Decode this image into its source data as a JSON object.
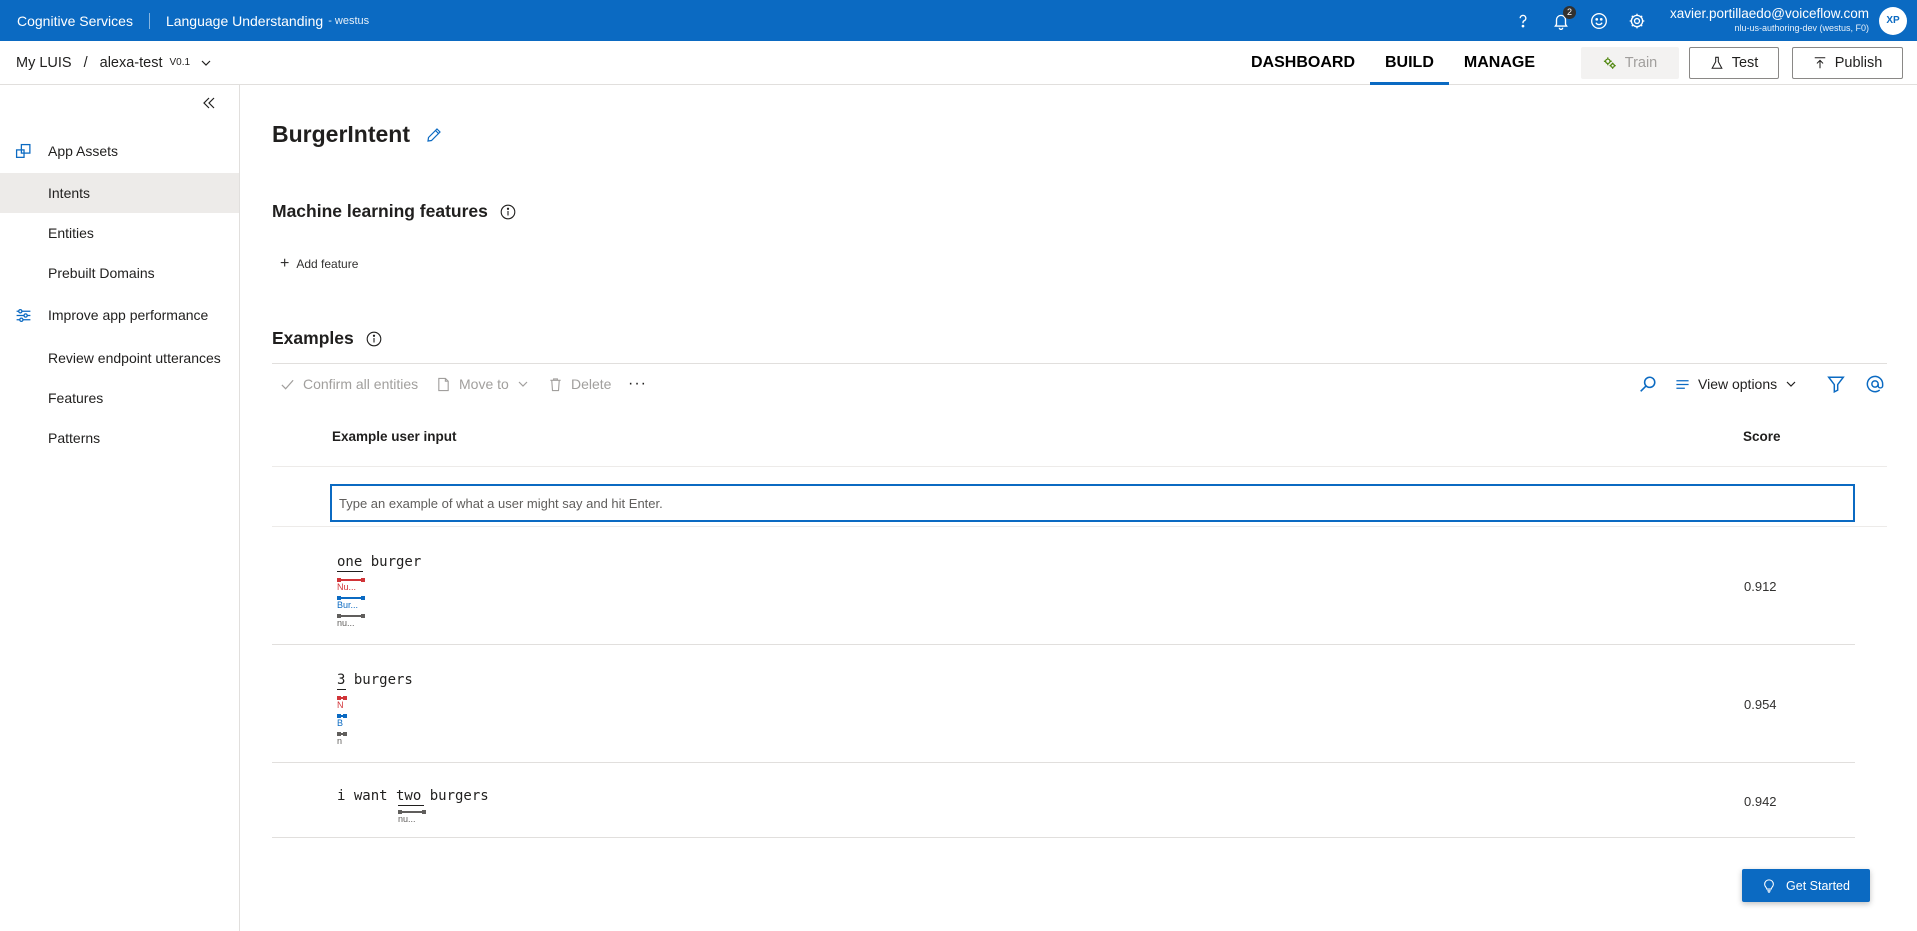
{
  "topbar": {
    "brand": "Cognitive Services",
    "product": "Language Understanding",
    "region": "- westus",
    "notification_count": "2",
    "user_email": "xavier.portillaedo@voiceflow.com",
    "user_tenant": "nlu-us-authoring-dev (westus, F0)",
    "avatar_initials": "XP"
  },
  "breadcrumb": {
    "root": "My LUIS",
    "separator": "/",
    "app": "alexa-test",
    "version": "V0.1"
  },
  "nav": {
    "tabs": [
      {
        "label": "DASHBOARD",
        "active": false
      },
      {
        "label": "BUILD",
        "active": true
      },
      {
        "label": "MANAGE",
        "active": false
      }
    ],
    "train_label": "Train",
    "test_label": "Test",
    "publish_label": "Publish"
  },
  "sidebar": {
    "items": [
      {
        "label": "App Assets",
        "icon": "app-assets-icon"
      },
      {
        "label": "Intents",
        "active": true
      },
      {
        "label": "Entities"
      },
      {
        "label": "Prebuilt Domains"
      },
      {
        "label": "Improve app performance",
        "icon": "sliders-icon"
      },
      {
        "label": "Review endpoint utterances"
      },
      {
        "label": "Features"
      },
      {
        "label": "Patterns"
      }
    ]
  },
  "main": {
    "intent_name": "BurgerIntent",
    "ml_features_heading": "Machine learning features",
    "add_feature_label": "Add feature",
    "examples_heading": "Examples",
    "toolbar": {
      "confirm_label": "Confirm all entities",
      "move_label": "Move to",
      "delete_label": "Delete",
      "more_label": "···",
      "view_options_label": "View options"
    },
    "table": {
      "col_input": "Example user input",
      "col_score": "Score",
      "input_placeholder": "Type an example of what a user might say and hit Enter.",
      "rows": [
        {
          "text": "one burger",
          "score": "0.912",
          "tags": [
            "Nu...",
            "Bur...",
            "nu..."
          ]
        },
        {
          "text": "3 burgers",
          "score": "0.954",
          "tags": [
            "N",
            "B",
            "n"
          ]
        },
        {
          "text": "i want two burgers",
          "score": "0.942",
          "tags": [
            "nu..."
          ]
        }
      ]
    }
  },
  "get_started_label": "Get Started",
  "colors": {
    "brand_blue": "#0b6ac2",
    "entity_red": "#d13438",
    "entity_gray": "#605e5c"
  }
}
